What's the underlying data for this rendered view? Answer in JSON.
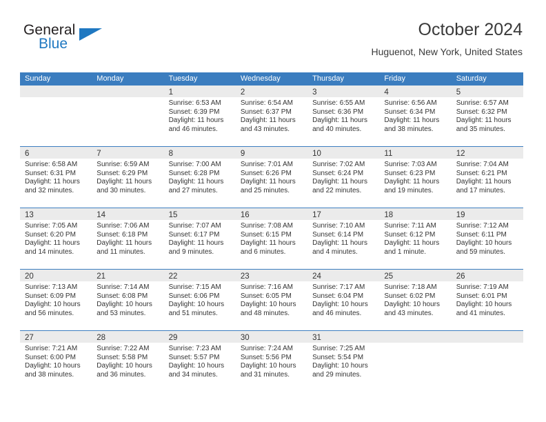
{
  "brand": {
    "name_top": "General",
    "name_bottom": "Blue",
    "accent_color": "#1f78c1",
    "triangle_icon": "brand-triangle-icon"
  },
  "header": {
    "title": "October 2024",
    "subtitle": "Huguenot, New York, United States"
  },
  "calendar": {
    "header_color": "#3b7dbf",
    "date_strip_color": "#ebebeb",
    "weekdays": [
      "Sunday",
      "Monday",
      "Tuesday",
      "Wednesday",
      "Thursday",
      "Friday",
      "Saturday"
    ],
    "weeks": [
      [
        {
          "day": "",
          "sunrise": "",
          "sunset": "",
          "daylight": "",
          "empty": true
        },
        {
          "day": "",
          "sunrise": "",
          "sunset": "",
          "daylight": "",
          "empty": true
        },
        {
          "day": "1",
          "sunrise": "Sunrise: 6:53 AM",
          "sunset": "Sunset: 6:39 PM",
          "daylight": "Daylight: 11 hours and 46 minutes."
        },
        {
          "day": "2",
          "sunrise": "Sunrise: 6:54 AM",
          "sunset": "Sunset: 6:37 PM",
          "daylight": "Daylight: 11 hours and 43 minutes."
        },
        {
          "day": "3",
          "sunrise": "Sunrise: 6:55 AM",
          "sunset": "Sunset: 6:36 PM",
          "daylight": "Daylight: 11 hours and 40 minutes."
        },
        {
          "day": "4",
          "sunrise": "Sunrise: 6:56 AM",
          "sunset": "Sunset: 6:34 PM",
          "daylight": "Daylight: 11 hours and 38 minutes."
        },
        {
          "day": "5",
          "sunrise": "Sunrise: 6:57 AM",
          "sunset": "Sunset: 6:32 PM",
          "daylight": "Daylight: 11 hours and 35 minutes."
        }
      ],
      [
        {
          "day": "6",
          "sunrise": "Sunrise: 6:58 AM",
          "sunset": "Sunset: 6:31 PM",
          "daylight": "Daylight: 11 hours and 32 minutes."
        },
        {
          "day": "7",
          "sunrise": "Sunrise: 6:59 AM",
          "sunset": "Sunset: 6:29 PM",
          "daylight": "Daylight: 11 hours and 30 minutes."
        },
        {
          "day": "8",
          "sunrise": "Sunrise: 7:00 AM",
          "sunset": "Sunset: 6:28 PM",
          "daylight": "Daylight: 11 hours and 27 minutes."
        },
        {
          "day": "9",
          "sunrise": "Sunrise: 7:01 AM",
          "sunset": "Sunset: 6:26 PM",
          "daylight": "Daylight: 11 hours and 25 minutes."
        },
        {
          "day": "10",
          "sunrise": "Sunrise: 7:02 AM",
          "sunset": "Sunset: 6:24 PM",
          "daylight": "Daylight: 11 hours and 22 minutes."
        },
        {
          "day": "11",
          "sunrise": "Sunrise: 7:03 AM",
          "sunset": "Sunset: 6:23 PM",
          "daylight": "Daylight: 11 hours and 19 minutes."
        },
        {
          "day": "12",
          "sunrise": "Sunrise: 7:04 AM",
          "sunset": "Sunset: 6:21 PM",
          "daylight": "Daylight: 11 hours and 17 minutes."
        }
      ],
      [
        {
          "day": "13",
          "sunrise": "Sunrise: 7:05 AM",
          "sunset": "Sunset: 6:20 PM",
          "daylight": "Daylight: 11 hours and 14 minutes."
        },
        {
          "day": "14",
          "sunrise": "Sunrise: 7:06 AM",
          "sunset": "Sunset: 6:18 PM",
          "daylight": "Daylight: 11 hours and 11 minutes."
        },
        {
          "day": "15",
          "sunrise": "Sunrise: 7:07 AM",
          "sunset": "Sunset: 6:17 PM",
          "daylight": "Daylight: 11 hours and 9 minutes."
        },
        {
          "day": "16",
          "sunrise": "Sunrise: 7:08 AM",
          "sunset": "Sunset: 6:15 PM",
          "daylight": "Daylight: 11 hours and 6 minutes."
        },
        {
          "day": "17",
          "sunrise": "Sunrise: 7:10 AM",
          "sunset": "Sunset: 6:14 PM",
          "daylight": "Daylight: 11 hours and 4 minutes."
        },
        {
          "day": "18",
          "sunrise": "Sunrise: 7:11 AM",
          "sunset": "Sunset: 6:12 PM",
          "daylight": "Daylight: 11 hours and 1 minute."
        },
        {
          "day": "19",
          "sunrise": "Sunrise: 7:12 AM",
          "sunset": "Sunset: 6:11 PM",
          "daylight": "Daylight: 10 hours and 59 minutes."
        }
      ],
      [
        {
          "day": "20",
          "sunrise": "Sunrise: 7:13 AM",
          "sunset": "Sunset: 6:09 PM",
          "daylight": "Daylight: 10 hours and 56 minutes."
        },
        {
          "day": "21",
          "sunrise": "Sunrise: 7:14 AM",
          "sunset": "Sunset: 6:08 PM",
          "daylight": "Daylight: 10 hours and 53 minutes."
        },
        {
          "day": "22",
          "sunrise": "Sunrise: 7:15 AM",
          "sunset": "Sunset: 6:06 PM",
          "daylight": "Daylight: 10 hours and 51 minutes."
        },
        {
          "day": "23",
          "sunrise": "Sunrise: 7:16 AM",
          "sunset": "Sunset: 6:05 PM",
          "daylight": "Daylight: 10 hours and 48 minutes."
        },
        {
          "day": "24",
          "sunrise": "Sunrise: 7:17 AM",
          "sunset": "Sunset: 6:04 PM",
          "daylight": "Daylight: 10 hours and 46 minutes."
        },
        {
          "day": "25",
          "sunrise": "Sunrise: 7:18 AM",
          "sunset": "Sunset: 6:02 PM",
          "daylight": "Daylight: 10 hours and 43 minutes."
        },
        {
          "day": "26",
          "sunrise": "Sunrise: 7:19 AM",
          "sunset": "Sunset: 6:01 PM",
          "daylight": "Daylight: 10 hours and 41 minutes."
        }
      ],
      [
        {
          "day": "27",
          "sunrise": "Sunrise: 7:21 AM",
          "sunset": "Sunset: 6:00 PM",
          "daylight": "Daylight: 10 hours and 38 minutes."
        },
        {
          "day": "28",
          "sunrise": "Sunrise: 7:22 AM",
          "sunset": "Sunset: 5:58 PM",
          "daylight": "Daylight: 10 hours and 36 minutes."
        },
        {
          "day": "29",
          "sunrise": "Sunrise: 7:23 AM",
          "sunset": "Sunset: 5:57 PM",
          "daylight": "Daylight: 10 hours and 34 minutes."
        },
        {
          "day": "30",
          "sunrise": "Sunrise: 7:24 AM",
          "sunset": "Sunset: 5:56 PM",
          "daylight": "Daylight: 10 hours and 31 minutes."
        },
        {
          "day": "31",
          "sunrise": "Sunrise: 7:25 AM",
          "sunset": "Sunset: 5:54 PM",
          "daylight": "Daylight: 10 hours and 29 minutes."
        },
        {
          "day": "",
          "sunrise": "",
          "sunset": "",
          "daylight": "",
          "empty": true
        },
        {
          "day": "",
          "sunrise": "",
          "sunset": "",
          "daylight": "",
          "empty": true
        }
      ]
    ]
  }
}
